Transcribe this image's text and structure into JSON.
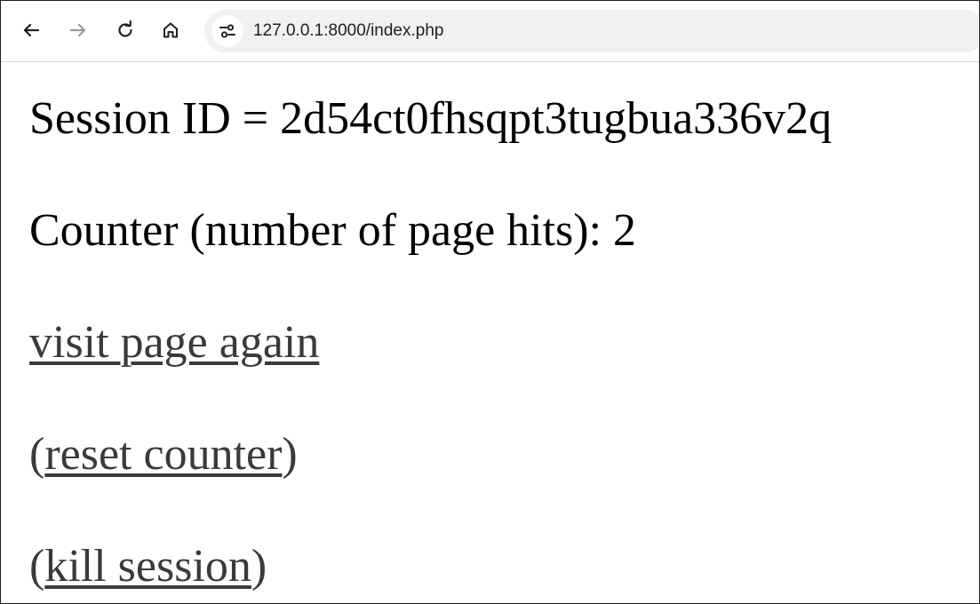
{
  "browser": {
    "url": "127.0.0.1:8000/index.php",
    "icons": {
      "back": "back-arrow-icon",
      "forward": "forward-arrow-icon",
      "reload": "reload-icon",
      "home": "home-icon",
      "site_info": "site-settings-icon"
    }
  },
  "page": {
    "session_line": "Session ID = 2d54ct0fhsqpt3tugbua336v2q",
    "counter_line": "Counter (number of page hits): 2",
    "visit_link": "visit page again",
    "reset_open": "(",
    "reset_link": "reset counter",
    "reset_close": ")",
    "kill_open": "(",
    "kill_link": "kill session",
    "kill_close": ")"
  },
  "colors": {
    "link": "#3a3a3a",
    "text": "#000000",
    "omnibox": "#f1f1f1"
  }
}
